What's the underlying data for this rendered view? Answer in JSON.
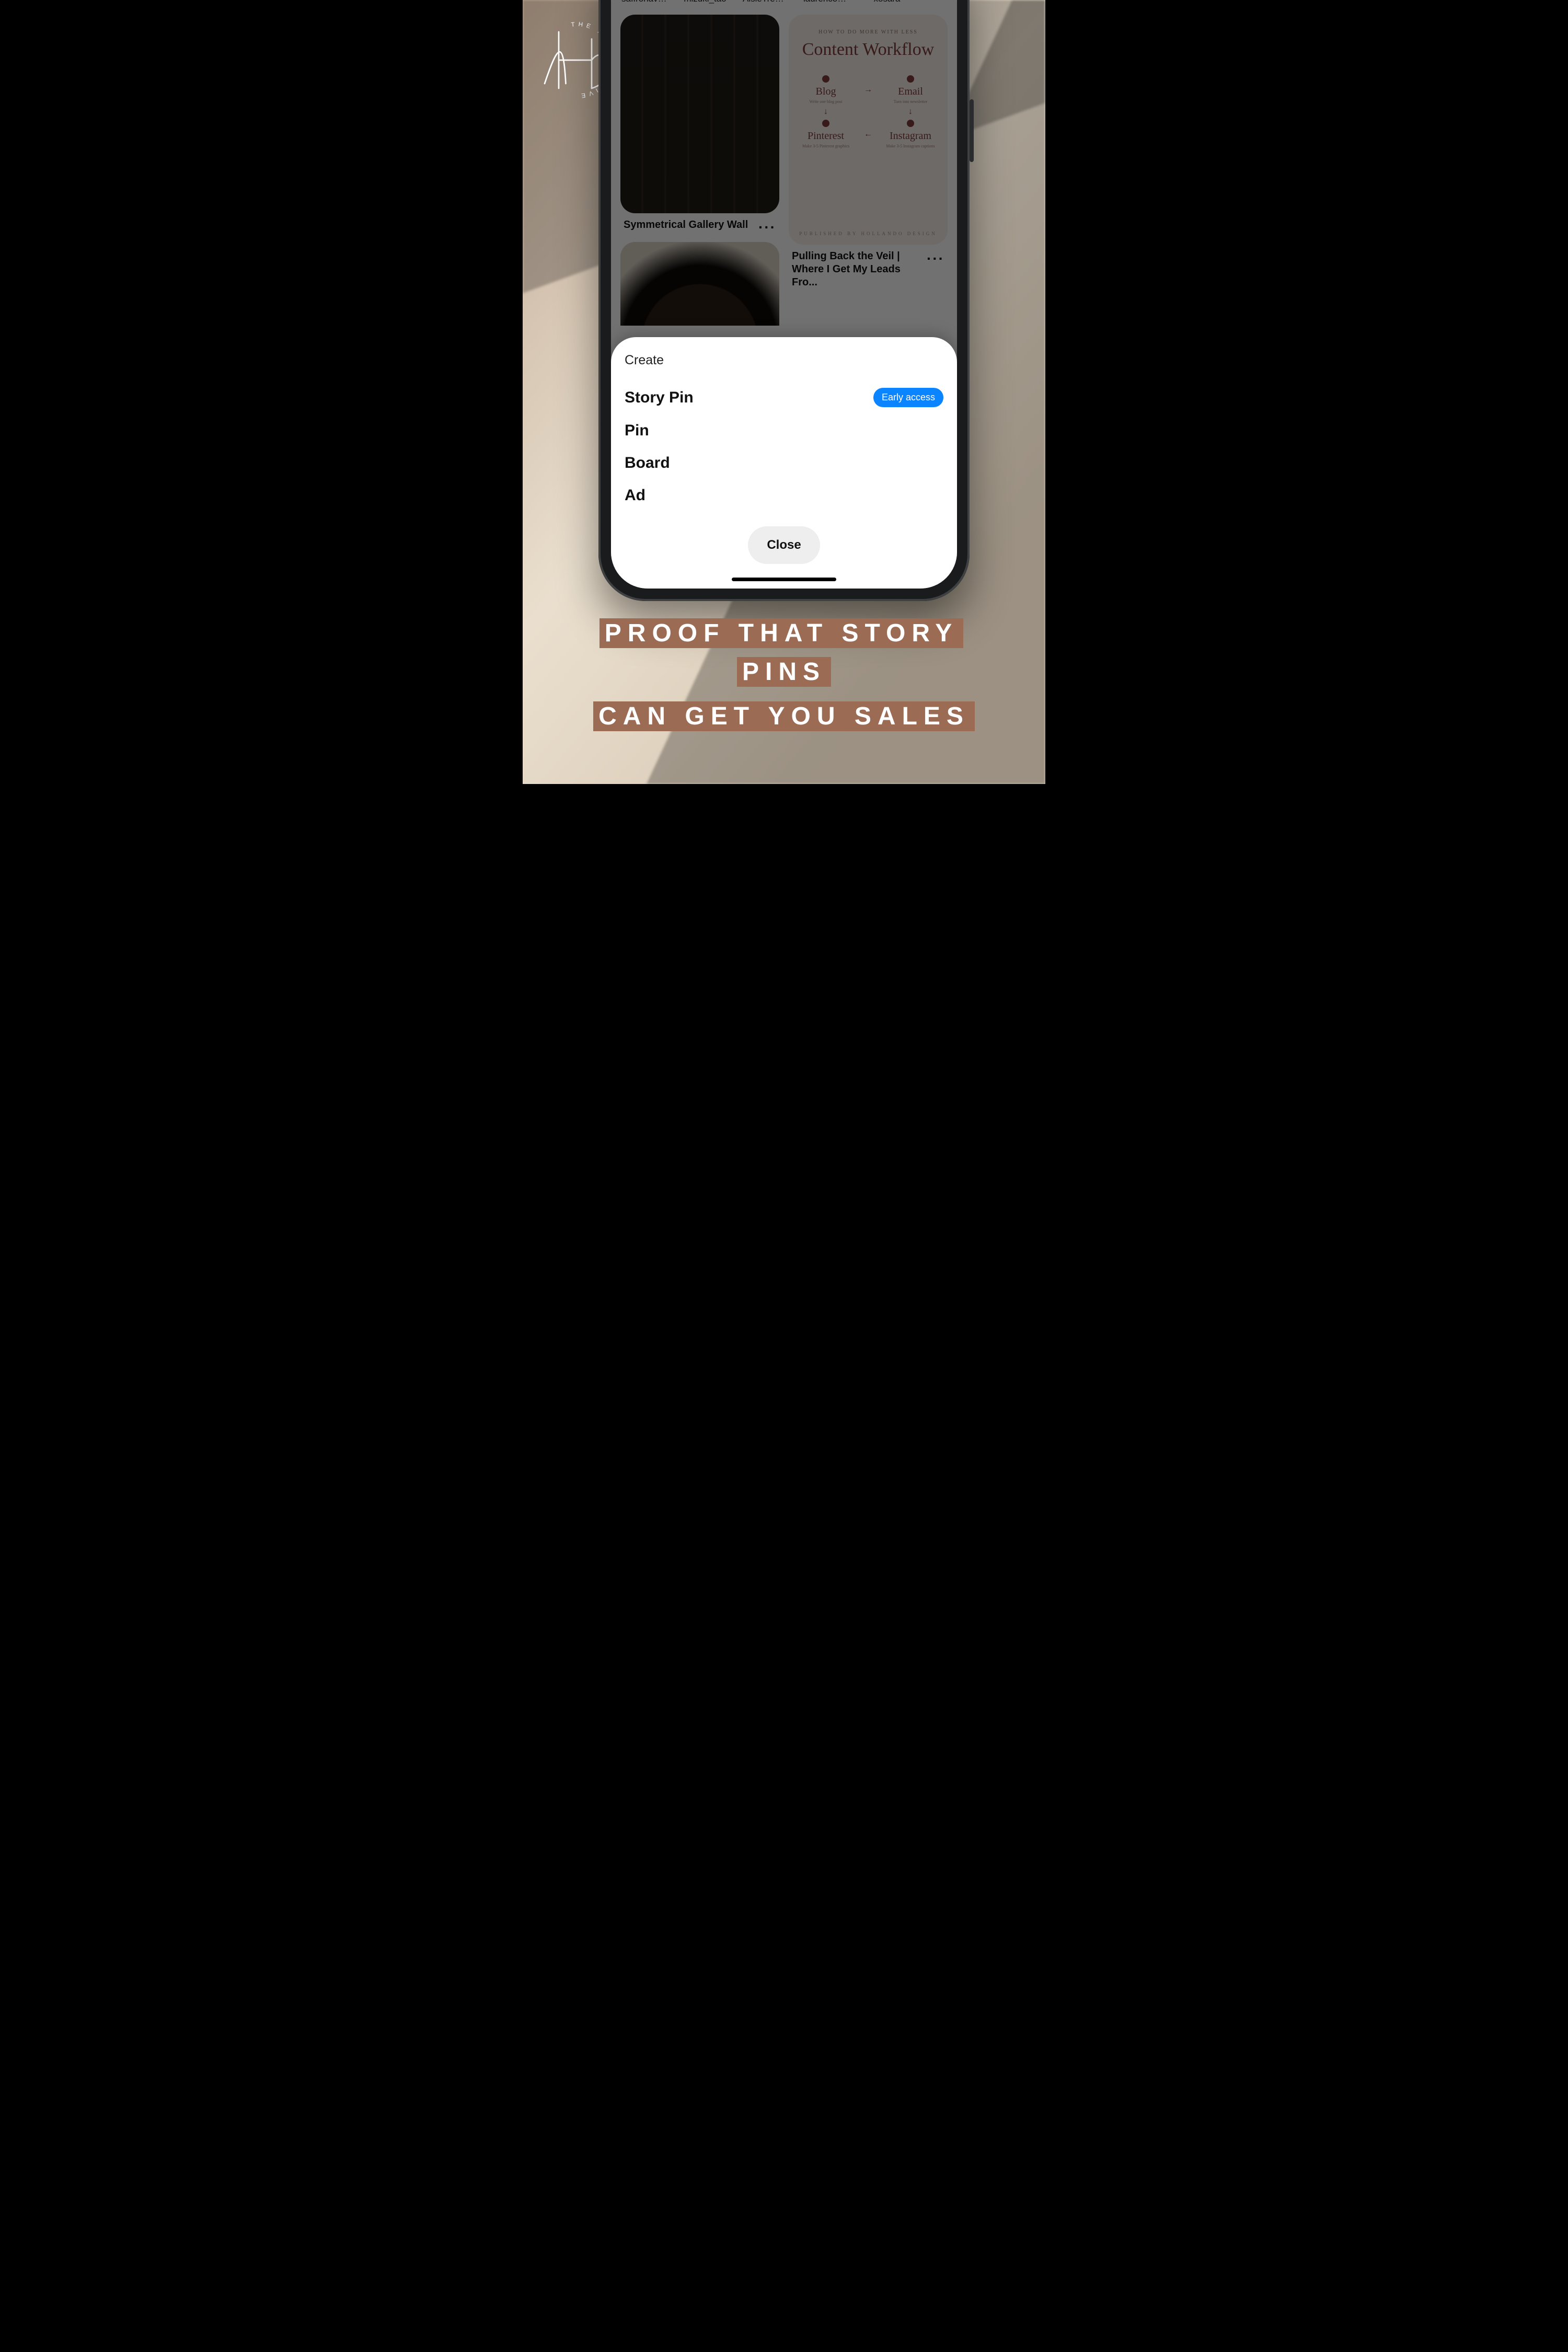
{
  "brand": {
    "name": "THE HALCYON HIVE",
    "mono": "thh"
  },
  "stories": [
    {
      "label": "saffronavenue",
      "color": "#d9c1a8"
    },
    {
      "label": "mizuki_tao",
      "color": "#1d1d1d"
    },
    {
      "label": "AisleTrendsby...",
      "color": "#0e8f7e"
    },
    {
      "label": "laurenconradco",
      "color": "#e6d3c3"
    },
    {
      "label": "xosara",
      "color": "#dfcab6"
    }
  ],
  "feed": {
    "left_pin": {
      "title": "Symmetrical Gallery Wall"
    },
    "right_pin": {
      "title": "Pulling Back the Veil | Where I Get My Leads Fro..."
    },
    "workflow": {
      "kicker": "HOW TO DO MORE WITH LESS",
      "title": "Content Workflow",
      "nodes": [
        "Blog",
        "Email",
        "Pinterest",
        "Instagram"
      ],
      "subs": [
        "Write one blog post",
        "Turn into newsletter",
        "Make 3-5 Pinterest graphics",
        "Make 3-5 Instagram captions"
      ],
      "footer": "PUBLISHED BY   HOLLANDO DESIGN"
    }
  },
  "sheet": {
    "heading": "Create",
    "options": [
      {
        "label": "Story Pin",
        "badge": "Early access"
      },
      {
        "label": "Pin"
      },
      {
        "label": "Board"
      },
      {
        "label": "Ad"
      }
    ],
    "close": "Close"
  },
  "caption": {
    "line1": "PROOF THAT STORY PINS",
    "line2": "CAN GET YOU SALES"
  },
  "colors": {
    "accent": "#0a84ff",
    "highlight": "#9b6b53"
  }
}
